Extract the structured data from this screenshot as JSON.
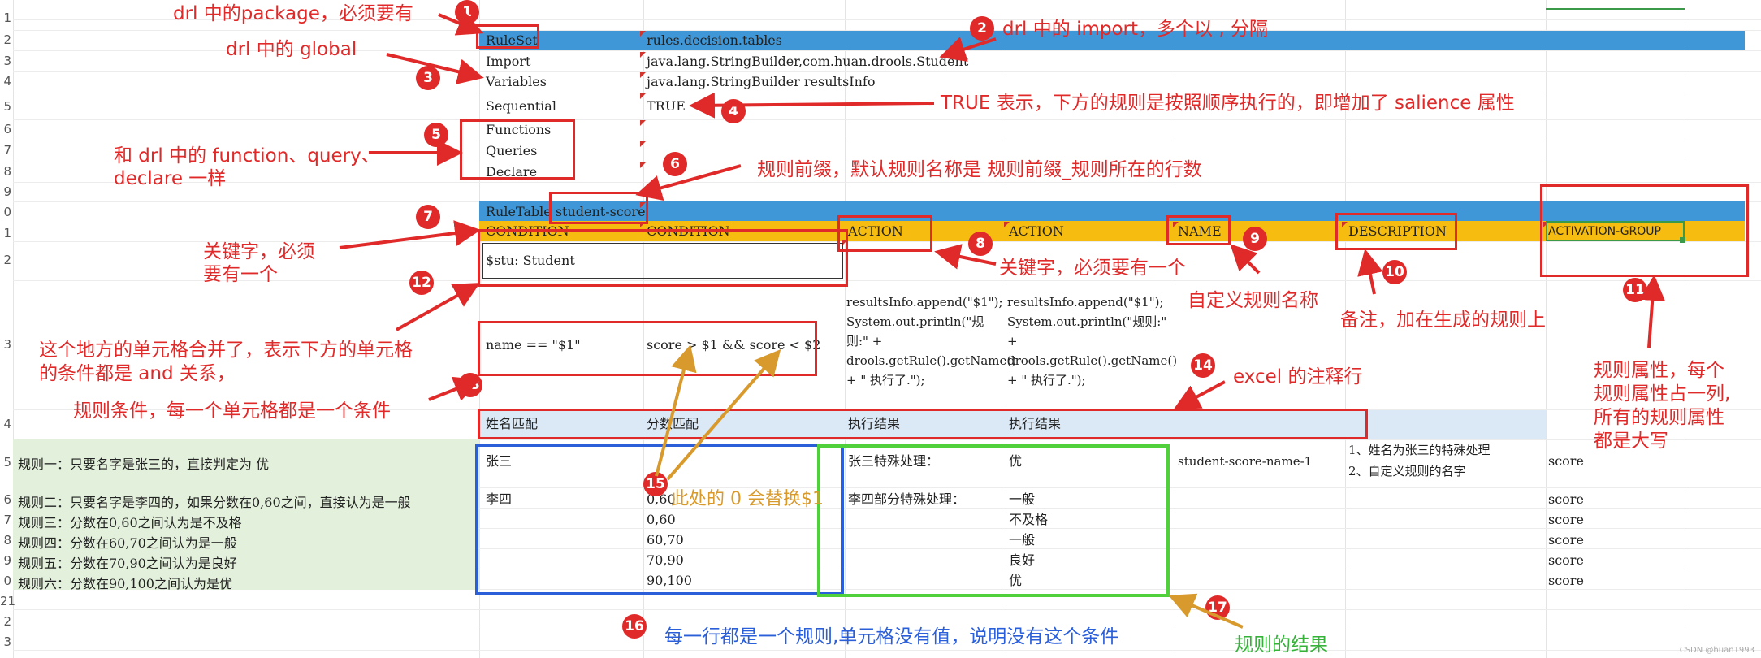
{
  "rows": [
    "1",
    "2",
    "3",
    "4",
    "5",
    "6",
    "7",
    "8",
    "9",
    "0",
    "1",
    "2",
    "",
    "3",
    "4",
    "5",
    "6",
    "7",
    "8",
    "9",
    "0",
    "21",
    "2",
    "3"
  ],
  "config": {
    "ruleset_label": "RuleSet",
    "ruleset_value": "rules.decision.tables",
    "import_label": "Import",
    "import_value": "java.lang.StringBuilder,com.huan.drools.Student",
    "variables_label": "Variables",
    "variables_value": "java.lang.StringBuilder resultsInfo",
    "sequential_label": "Sequential",
    "sequential_value": "TRUE",
    "functions_label": "Functions",
    "queries_label": "Queries",
    "declare_label": "Declare"
  },
  "table": {
    "ruletable": "RuleTable student-score",
    "headers": [
      "CONDITION",
      "CONDITION",
      "ACTION",
      "ACTION",
      "NAME",
      "DESCRIPTION",
      "ACTIVATION-GROUP"
    ],
    "object_type": "$stu: Student",
    "cond1": "name == \"$1\"",
    "cond2": "score > $1 && score < $2",
    "action1": "resultsInfo.append(\"$1\"); System.out.println(\"规则:\" + drools.getRule().getName() + \" 执行了.\");",
    "action2": "resultsInfo.append(\"$1\"); System.out.println(\"规则:\" + drools.getRule().getName() + \" 执行了.\");",
    "comments": [
      "姓名匹配",
      "分数匹配",
      "执行结果",
      "执行结果"
    ],
    "rules": [
      {
        "desc": "规则一：只要名字是张三的，直接判定为 优",
        "name": "张三",
        "score": "",
        "a1": "张三特殊处理：",
        "a2": "优",
        "rname": "student-score-name-1",
        "d1": "1、姓名为张三的特殊处理",
        "d2": "2、自定义规则的名字",
        "grp": "score"
      },
      {
        "desc": "规则二：只要名字是李四的，如果分数在0,60之间，直接认为是一般",
        "name": "李四",
        "score": "0,60",
        "a1": "李四部分特殊处理：",
        "a2": "一般",
        "rname": "",
        "d1": "",
        "d2": "",
        "grp": "score"
      },
      {
        "desc": "规则三：分数在0,60之间认为是不及格",
        "name": "",
        "score": "0,60",
        "a1": "",
        "a2": "不及格",
        "rname": "",
        "d1": "",
        "d2": "",
        "grp": "score"
      },
      {
        "desc": "规则四：分数在60,70之间认为是一般",
        "name": "",
        "score": "60,70",
        "a1": "",
        "a2": "一般",
        "rname": "",
        "d1": "",
        "d2": "",
        "grp": "score"
      },
      {
        "desc": "规则五：分数在70,90之间认为是良好",
        "name": "",
        "score": "70,90",
        "a1": "",
        "a2": "良好",
        "rname": "",
        "d1": "",
        "d2": "",
        "grp": "score"
      },
      {
        "desc": "规则六：分数在90,100之间认为是优",
        "name": "",
        "score": "90,100",
        "a1": "",
        "a2": "优",
        "rname": "",
        "d1": "",
        "d2": "",
        "grp": "score"
      }
    ]
  },
  "annotations": {
    "a1": "drl 中的package，必须要有",
    "a2": "drl 中的 import，多个以 , 分隔",
    "a3": "drl 中的 global",
    "a4": "TRUE 表示，下方的规则是按照顺序执行的，即增加了 salience 属性",
    "a5_line1": "和 drl 中的 function、query、",
    "a5_line2": "declare 一样",
    "a6": "规则前缀，默认规则名称是 规则前缀_规则所在的行数",
    "a7_line1": "关键字，必须",
    "a7_line2": "要有一个",
    "a8": "关键字，必须要有一个",
    "a9": "自定义规则名称",
    "a10": "备注，加在生成的规则上",
    "a11_line1": "规则属性，每个",
    "a11_line2": "规则属性占一列,",
    "a11_line3": "所有的规则属性",
    "a11_line4": "都是大写",
    "a12_line1": "这个地方的单元格合并了，表示下方的单元格",
    "a12_line2": "的条件都是 and 关系，",
    "a13": "规则条件，每一个单元格都是一个条件",
    "a14": "excel 的注释行",
    "a15": "此处的 0 会替换$1",
    "a16": "每一行都是一个规则,单元格没有值，说明没有这个条件",
    "a17": "规则的结果"
  },
  "badges": [
    "1",
    "2",
    "3",
    "4",
    "5",
    "6",
    "7",
    "8",
    "9",
    "10",
    "11",
    "12",
    "13",
    "14",
    "15",
    "16",
    "17"
  ],
  "watermark": "CSDN @huan1993",
  "colors": {
    "blue_band": "#3f97d8",
    "orange_band": "#f6bd10",
    "red": "#e02a2a",
    "blue": "#2b5fd9",
    "green": "#36b23a",
    "orange_arrow": "#d89a2c",
    "green_cells": "#e3f1dc"
  }
}
